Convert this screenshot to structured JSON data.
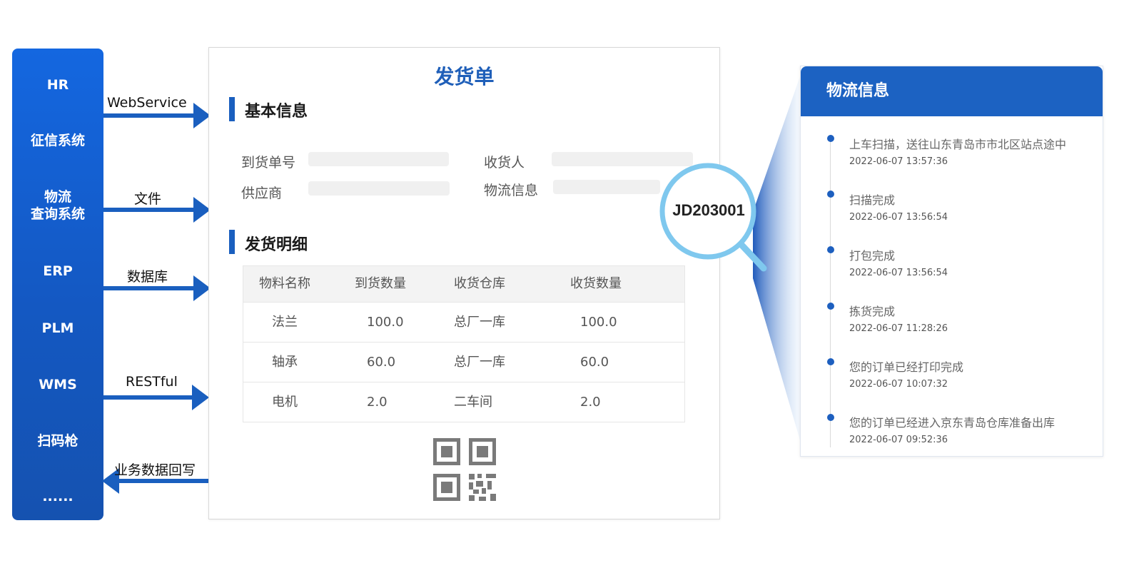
{
  "systems": [
    "HR",
    "征信系统",
    "物流\n查询系统",
    "ERP",
    "PLM",
    "WMS",
    "扫码枪",
    "......"
  ],
  "connectors": [
    {
      "label": "WebService",
      "direction": "right"
    },
    {
      "label": "文件",
      "direction": "right"
    },
    {
      "label": "数据库",
      "direction": "right"
    },
    {
      "label": "RESTful",
      "direction": "right"
    },
    {
      "label": "业务数据回写",
      "direction": "left"
    }
  ],
  "document": {
    "title": "发货单",
    "basic_section": "基本信息",
    "fields": {
      "arrival_no": "到货单号",
      "receiver": "收货人",
      "supplier": "供应商",
      "logistics_info": "物流信息"
    },
    "detail_section": "发货明细",
    "table": {
      "headers": [
        "物料名称",
        "到货数量",
        "收货仓库",
        "收货数量"
      ],
      "rows": [
        [
          "法兰",
          "100.0",
          "总厂一库",
          "100.0"
        ],
        [
          "轴承",
          "60.0",
          "总厂一库",
          "60.0"
        ],
        [
          "电机",
          "2.0",
          "二车间",
          "2.0"
        ]
      ]
    }
  },
  "magnifier": {
    "code": "JD203001"
  },
  "logistics": {
    "title": "物流信息",
    "events": [
      {
        "status": "上车扫描，送往山东青岛市市北区站点途中",
        "time": "2022-06-07 13:57:36"
      },
      {
        "status": "扫描完成",
        "time": "2022-06-07 13:56:54"
      },
      {
        "status": "打包完成",
        "time": "2022-06-07 13:56:54"
      },
      {
        "status": "拣货完成",
        "time": "2022-06-07 11:28:26"
      },
      {
        "status": "您的订单已经打印完成",
        "time": "2022-06-07 10:07:32"
      },
      {
        "status": "您的订单已经进入京东青岛仓库准备出库",
        "time": "2022-06-07 09:52:36"
      }
    ]
  },
  "colors": {
    "primary": "#1a5fbf",
    "magnifier_ring": "#7fc8ee",
    "field_placeholder": "#f0f0f0"
  }
}
